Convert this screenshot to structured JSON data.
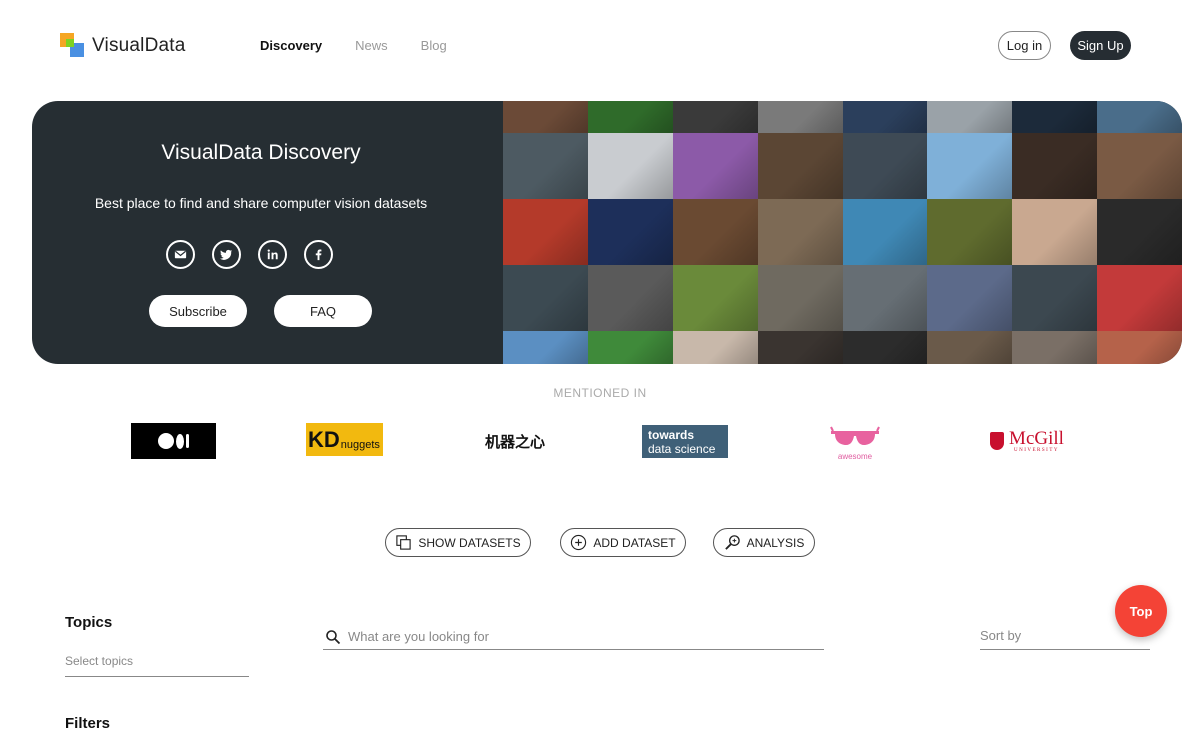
{
  "header": {
    "logo_text": "VisualData",
    "nav": [
      {
        "label": "Discovery",
        "active": true
      },
      {
        "label": "News",
        "active": false
      },
      {
        "label": "Blog",
        "active": false
      }
    ],
    "login_label": "Log in",
    "signup_label": "Sign Up"
  },
  "hero": {
    "title": "VisualData Discovery",
    "subtitle": "Best place to find and share computer vision datasets",
    "social": [
      {
        "icon": "email-icon"
      },
      {
        "icon": "twitter-icon"
      },
      {
        "icon": "linkedin-icon"
      },
      {
        "icon": "facebook-icon"
      }
    ],
    "subscribe_label": "Subscribe",
    "faq_label": "FAQ",
    "mosaic_colors": [
      "#6b4a37",
      "#2f6b2a",
      "#3a3a3a",
      "#7a7a7a",
      "#2b3f5c",
      "#9aa2a8",
      "#1c2a3a",
      "#4a6d8a",
      "#4d5a62",
      "#c9ccd0",
      "#8c5aa8",
      "#5b4634",
      "#3e4a55",
      "#7fb0d8",
      "#3a2c24",
      "#7a5a44",
      "#b43a2a",
      "#1d2f5a",
      "#6a4a32",
      "#7d6a55",
      "#3f88b5",
      "#5f6b2e",
      "#c9a890",
      "#2a2a2a",
      "#3c4a52",
      "#5a5a5a",
      "#6a8a3a",
      "#6f6a60",
      "#666e74",
      "#5c6a8a",
      "#3c4850",
      "#c33a3a",
      "#5b8fc2",
      "#3f8a3a",
      "#c8b8aa",
      "#3a3430",
      "#2c2c2c",
      "#6a5a4a",
      "#7a6f66",
      "#b5624a"
    ]
  },
  "mentioned": {
    "heading": "MENTIONED IN",
    "logos": {
      "kd_big": "KD",
      "kd_small": "nuggets",
      "jqzx": "机器之心",
      "tds_line1": "towards",
      "tds_line2": "data science",
      "awesome": "awesome",
      "mcgill": "McGill",
      "mcgill_sub": "UNIVERSITY"
    }
  },
  "actions": {
    "show": "SHOW DATASETS",
    "add": "ADD DATASET",
    "analysis": "ANALYSIS"
  },
  "fab": {
    "top_label": "Top"
  },
  "filters": {
    "topics_title": "Topics",
    "topics_placeholder": "Select topics",
    "filters_title": "Filters",
    "search_placeholder": "What are you looking for",
    "sort_label": "Sort by"
  },
  "colors": {
    "dark": "#262e33",
    "accent_red": "#f44336"
  }
}
